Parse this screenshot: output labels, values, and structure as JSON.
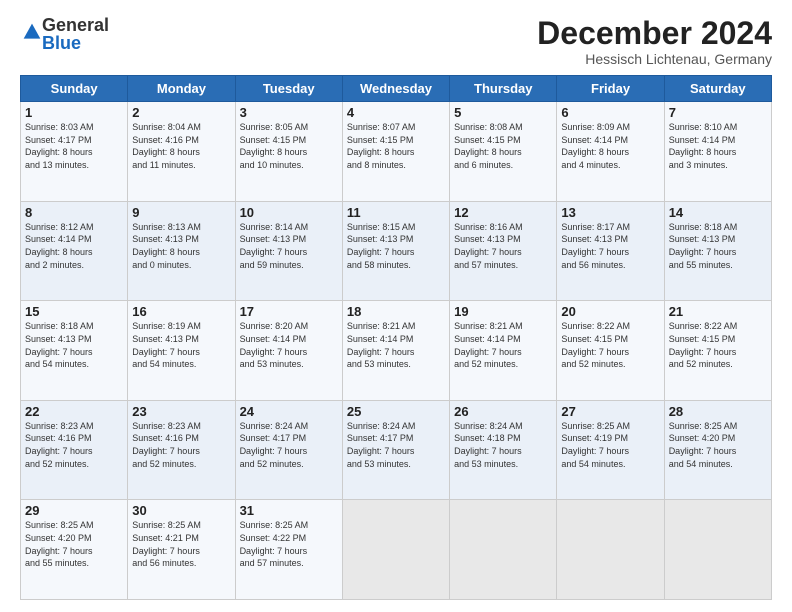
{
  "header": {
    "logo_general": "General",
    "logo_blue": "Blue",
    "month_title": "December 2024",
    "location": "Hessisch Lichtenau, Germany"
  },
  "weekdays": [
    "Sunday",
    "Monday",
    "Tuesday",
    "Wednesday",
    "Thursday",
    "Friday",
    "Saturday"
  ],
  "weeks": [
    [
      {
        "day": "1",
        "lines": [
          "Sunrise: 8:03 AM",
          "Sunset: 4:17 PM",
          "Daylight: 8 hours",
          "and 13 minutes."
        ]
      },
      {
        "day": "2",
        "lines": [
          "Sunrise: 8:04 AM",
          "Sunset: 4:16 PM",
          "Daylight: 8 hours",
          "and 11 minutes."
        ]
      },
      {
        "day": "3",
        "lines": [
          "Sunrise: 8:05 AM",
          "Sunset: 4:15 PM",
          "Daylight: 8 hours",
          "and 10 minutes."
        ]
      },
      {
        "day": "4",
        "lines": [
          "Sunrise: 8:07 AM",
          "Sunset: 4:15 PM",
          "Daylight: 8 hours",
          "and 8 minutes."
        ]
      },
      {
        "day": "5",
        "lines": [
          "Sunrise: 8:08 AM",
          "Sunset: 4:15 PM",
          "Daylight: 8 hours",
          "and 6 minutes."
        ]
      },
      {
        "day": "6",
        "lines": [
          "Sunrise: 8:09 AM",
          "Sunset: 4:14 PM",
          "Daylight: 8 hours",
          "and 4 minutes."
        ]
      },
      {
        "day": "7",
        "lines": [
          "Sunrise: 8:10 AM",
          "Sunset: 4:14 PM",
          "Daylight: 8 hours",
          "and 3 minutes."
        ]
      }
    ],
    [
      {
        "day": "8",
        "lines": [
          "Sunrise: 8:12 AM",
          "Sunset: 4:14 PM",
          "Daylight: 8 hours",
          "and 2 minutes."
        ]
      },
      {
        "day": "9",
        "lines": [
          "Sunrise: 8:13 AM",
          "Sunset: 4:13 PM",
          "Daylight: 8 hours",
          "and 0 minutes."
        ]
      },
      {
        "day": "10",
        "lines": [
          "Sunrise: 8:14 AM",
          "Sunset: 4:13 PM",
          "Daylight: 7 hours",
          "and 59 minutes."
        ]
      },
      {
        "day": "11",
        "lines": [
          "Sunrise: 8:15 AM",
          "Sunset: 4:13 PM",
          "Daylight: 7 hours",
          "and 58 minutes."
        ]
      },
      {
        "day": "12",
        "lines": [
          "Sunrise: 8:16 AM",
          "Sunset: 4:13 PM",
          "Daylight: 7 hours",
          "and 57 minutes."
        ]
      },
      {
        "day": "13",
        "lines": [
          "Sunrise: 8:17 AM",
          "Sunset: 4:13 PM",
          "Daylight: 7 hours",
          "and 56 minutes."
        ]
      },
      {
        "day": "14",
        "lines": [
          "Sunrise: 8:18 AM",
          "Sunset: 4:13 PM",
          "Daylight: 7 hours",
          "and 55 minutes."
        ]
      }
    ],
    [
      {
        "day": "15",
        "lines": [
          "Sunrise: 8:18 AM",
          "Sunset: 4:13 PM",
          "Daylight: 7 hours",
          "and 54 minutes."
        ]
      },
      {
        "day": "16",
        "lines": [
          "Sunrise: 8:19 AM",
          "Sunset: 4:13 PM",
          "Daylight: 7 hours",
          "and 54 minutes."
        ]
      },
      {
        "day": "17",
        "lines": [
          "Sunrise: 8:20 AM",
          "Sunset: 4:14 PM",
          "Daylight: 7 hours",
          "and 53 minutes."
        ]
      },
      {
        "day": "18",
        "lines": [
          "Sunrise: 8:21 AM",
          "Sunset: 4:14 PM",
          "Daylight: 7 hours",
          "and 53 minutes."
        ]
      },
      {
        "day": "19",
        "lines": [
          "Sunrise: 8:21 AM",
          "Sunset: 4:14 PM",
          "Daylight: 7 hours",
          "and 52 minutes."
        ]
      },
      {
        "day": "20",
        "lines": [
          "Sunrise: 8:22 AM",
          "Sunset: 4:15 PM",
          "Daylight: 7 hours",
          "and 52 minutes."
        ]
      },
      {
        "day": "21",
        "lines": [
          "Sunrise: 8:22 AM",
          "Sunset: 4:15 PM",
          "Daylight: 7 hours",
          "and 52 minutes."
        ]
      }
    ],
    [
      {
        "day": "22",
        "lines": [
          "Sunrise: 8:23 AM",
          "Sunset: 4:16 PM",
          "Daylight: 7 hours",
          "and 52 minutes."
        ]
      },
      {
        "day": "23",
        "lines": [
          "Sunrise: 8:23 AM",
          "Sunset: 4:16 PM",
          "Daylight: 7 hours",
          "and 52 minutes."
        ]
      },
      {
        "day": "24",
        "lines": [
          "Sunrise: 8:24 AM",
          "Sunset: 4:17 PM",
          "Daylight: 7 hours",
          "and 52 minutes."
        ]
      },
      {
        "day": "25",
        "lines": [
          "Sunrise: 8:24 AM",
          "Sunset: 4:17 PM",
          "Daylight: 7 hours",
          "and 53 minutes."
        ]
      },
      {
        "day": "26",
        "lines": [
          "Sunrise: 8:24 AM",
          "Sunset: 4:18 PM",
          "Daylight: 7 hours",
          "and 53 minutes."
        ]
      },
      {
        "day": "27",
        "lines": [
          "Sunrise: 8:25 AM",
          "Sunset: 4:19 PM",
          "Daylight: 7 hours",
          "and 54 minutes."
        ]
      },
      {
        "day": "28",
        "lines": [
          "Sunrise: 8:25 AM",
          "Sunset: 4:20 PM",
          "Daylight: 7 hours",
          "and 54 minutes."
        ]
      }
    ],
    [
      {
        "day": "29",
        "lines": [
          "Sunrise: 8:25 AM",
          "Sunset: 4:20 PM",
          "Daylight: 7 hours",
          "and 55 minutes."
        ]
      },
      {
        "day": "30",
        "lines": [
          "Sunrise: 8:25 AM",
          "Sunset: 4:21 PM",
          "Daylight: 7 hours",
          "and 56 minutes."
        ]
      },
      {
        "day": "31",
        "lines": [
          "Sunrise: 8:25 AM",
          "Sunset: 4:22 PM",
          "Daylight: 7 hours",
          "and 57 minutes."
        ]
      },
      {
        "day": "",
        "lines": []
      },
      {
        "day": "",
        "lines": []
      },
      {
        "day": "",
        "lines": []
      },
      {
        "day": "",
        "lines": []
      }
    ]
  ]
}
